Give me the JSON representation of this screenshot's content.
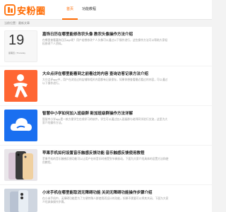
{
  "header": {
    "logo_text": "安粉圈",
    "nav": [
      "首页",
      "功能教程"
    ]
  },
  "breadcrumb": "当前位置：最新文章",
  "articles": [
    {
      "title": "嘉饰日历在哪里能修改农头像 教农头像操作方法介绍",
      "desc": "在哪里查看嘉饰日历app呢？用户若想修改个人头像可以通过以下操作进行，这些操作方法可以帮助大家轻松修改个人资料。",
      "thumb": "avatar",
      "thumb_text": "19",
      "thumb_sub": "星期四 | Thursday"
    },
    {
      "title": "大众点评在哪里能看到之前看过的内容 查询访客记录方法介绍",
      "desc": "大众点评app中，用户在浏览过的店铺和相关内容都有记录保存，如果你想查看最近看过的内容，可以通过以下操作进行。",
      "thumb": "dianping"
    },
    {
      "title": "智慧中小学如何加入班级群 新加班级群操作方法详解",
      "desc": "智慧中小学app是一款方便学生在线学习的软件，学生可以通过加入班级群与老师同学进行交流，这里为大家介绍操作方法。",
      "thumb": "cloud"
    },
    {
      "title": "苹果手机如何设置音乐触感反馈功能 音乐触感反馈使用教程",
      "desc": "苹果手机的音乐触感反馈功能可以让用户在听音乐时感受到节奏振动，下面为大家介绍具体的设置方法和使用教程。",
      "thumb": "phone"
    },
    {
      "title": "小米手机在哪里能取消无障碍功能 关闭无障碍功能操作步骤介绍",
      "desc": "在小米手机中，无障碍功能是为了方便特殊人群使用而设计的功能，如果不需要可以将其关闭，下面为大家介绍具体操作步骤。",
      "thumb": "xiaomi"
    }
  ],
  "colors": {
    "accent": "#ff6a00",
    "dianping_bg": "#ff6633",
    "cloud_bg": "#1a6ff0"
  }
}
